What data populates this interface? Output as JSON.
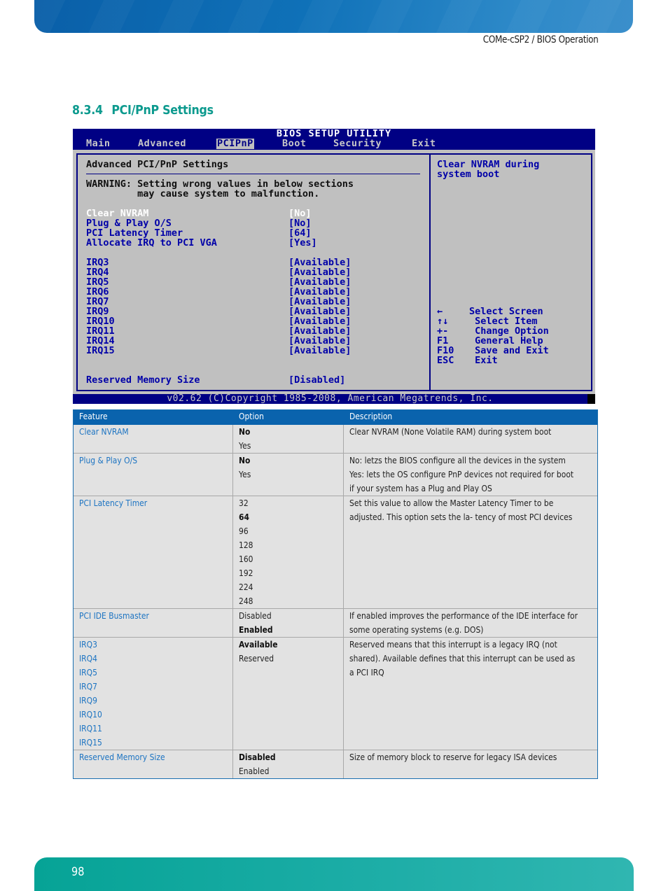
{
  "header": {
    "running_title": "COMe-cSP2 / BIOS Operation"
  },
  "section": {
    "number": "8.3.4",
    "title": "PCI/PnP Settings"
  },
  "bios": {
    "title": "BIOS SETUP UTILITY",
    "tabs": [
      {
        "label": "Main",
        "active": false
      },
      {
        "label": "Advanced",
        "active": false
      },
      {
        "label": "PCIPnP",
        "active": true
      },
      {
        "label": "Boot",
        "active": false
      },
      {
        "label": "Security",
        "active": false
      },
      {
        "label": "Exit",
        "active": false
      }
    ],
    "panel_title": "Advanced PCI/PnP Settings",
    "warning_line1": "WARNING: Setting wrong values in below sections",
    "warning_line2": "         may cause system to malfunction.",
    "settings": [
      {
        "label": "Clear NVRAM",
        "value": "[No]",
        "highlighted": true
      },
      {
        "label": "Plug & Play O/S",
        "value": "[No]"
      },
      {
        "label": "PCI Latency Timer",
        "value": "[64]"
      },
      {
        "label": "Allocate IRQ to PCI VGA",
        "value": "[Yes]"
      }
    ],
    "irqs": [
      {
        "label": "IRQ3",
        "value": "[Available]"
      },
      {
        "label": "IRQ4",
        "value": "[Available]"
      },
      {
        "label": "IRQ5",
        "value": "[Available]"
      },
      {
        "label": "IRQ6",
        "value": "[Available]"
      },
      {
        "label": "IRQ7",
        "value": "[Available]"
      },
      {
        "label": "IRQ9",
        "value": "[Available]"
      },
      {
        "label": "IRQ10",
        "value": "[Available]"
      },
      {
        "label": "IRQ11",
        "value": "[Available]"
      },
      {
        "label": "IRQ14",
        "value": "[Available]"
      },
      {
        "label": "IRQ15",
        "value": "[Available]"
      }
    ],
    "reserved_memory": {
      "label": "Reserved Memory Size",
      "value": "[Disabled]"
    },
    "help_line1": "Clear NVRAM during",
    "help_line2": "system boot",
    "keys": [
      {
        "key": "←",
        "action": "Select Screen"
      },
      {
        "key": "↑↓",
        "action": " Select Item"
      },
      {
        "key": "+-",
        "action": " Change Option"
      },
      {
        "key": "F1",
        "action": " General Help"
      },
      {
        "key": "F10",
        "action": " Save and Exit"
      },
      {
        "key": "ESC",
        "action": " Exit"
      }
    ],
    "footer": "v02.62 (C)Copyright 1985-2008, American Megatrends, Inc."
  },
  "table": {
    "headers": [
      "Feature",
      "Option",
      "Description"
    ],
    "rows": [
      {
        "features": [
          "Clear NVRAM"
        ],
        "options": [
          {
            "text": "No",
            "default": true
          },
          {
            "text": "Yes",
            "default": false
          }
        ],
        "description": [
          "Clear NVRAM (None Volatile RAM) during system boot"
        ]
      },
      {
        "features": [
          "Plug & Play O/S"
        ],
        "options": [
          {
            "text": "No",
            "default": true
          },
          {
            "text": "Yes",
            "default": false
          }
        ],
        "description": [
          "No: letzs the BIOS configure all the devices in the system",
          "Yes: lets the OS configure PnP devices not required for boot",
          "if your system has a Plug and Play OS"
        ]
      },
      {
        "features": [
          "PCI Latency Timer"
        ],
        "options": [
          {
            "text": "32",
            "default": false
          },
          {
            "text": "64",
            "default": true
          },
          {
            "text": "96",
            "default": false
          },
          {
            "text": "128",
            "default": false
          },
          {
            "text": "160",
            "default": false
          },
          {
            "text": "192",
            "default": false
          },
          {
            "text": "224",
            "default": false
          },
          {
            "text": "248",
            "default": false
          }
        ],
        "description": [
          "Set this value to allow the Master Latency Timer to be",
          "adjusted. This option sets the la- tency of most PCI devices"
        ]
      },
      {
        "features": [
          "PCI IDE Busmaster"
        ],
        "options": [
          {
            "text": "Disabled",
            "default": false
          },
          {
            "text": "Enabled",
            "default": true
          }
        ],
        "description": [
          "If enabled improves the performance of the IDE interface for",
          "some operating systems (e.g. DOS)"
        ]
      },
      {
        "features": [
          "IRQ3",
          "IRQ4",
          "IRQ5",
          "IRQ7",
          "IRQ9",
          "IRQ10",
          "IRQ11",
          "IRQ15"
        ],
        "options": [
          {
            "text": "Available",
            "default": true
          },
          {
            "text": "Reserved",
            "default": false
          }
        ],
        "description": [
          "Reserved means that this interrupt is a legacy IRQ (not",
          "shared). Available defines that this interrupt can be used as",
          "a PCI IRQ"
        ]
      },
      {
        "features": [
          "Reserved Memory Size"
        ],
        "options": [
          {
            "text": "Disabled",
            "default": true
          },
          {
            "text": "Enabled",
            "default": false
          }
        ],
        "description": [
          "Size of memory block to reserve for legacy ISA devices"
        ]
      }
    ]
  },
  "footer": {
    "page_number": "98"
  }
}
